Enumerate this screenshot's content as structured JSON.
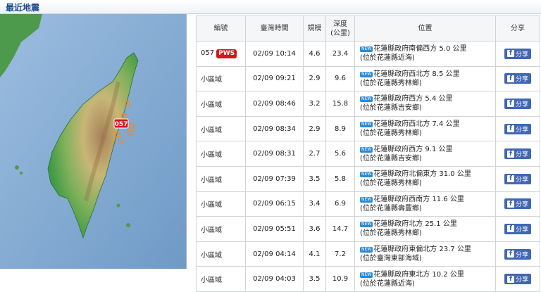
{
  "section_title": "最近地震",
  "table": {
    "headers": {
      "no": "編號",
      "time": "臺灣時間",
      "mag": "規模",
      "depth_line1": "深度",
      "depth_line2": "(公里)",
      "loc": "位置",
      "share": "分享"
    },
    "badge_new": "NEW",
    "share_label": "分享",
    "rows": [
      {
        "no": "057",
        "pws": "PWS",
        "time": "02/09 10:14",
        "mag": "4.6",
        "depth": "23.4",
        "loc1": "花蓮縣政府南偏西方 5.0 公里",
        "loc2": "(位於花蓮縣近海)"
      },
      {
        "no": "小區域",
        "time": "02/09 09:21",
        "mag": "2.9",
        "depth": "9.6",
        "loc1": "花蓮縣政府西北方 8.5 公里",
        "loc2": "(位於花蓮縣秀林鄉)"
      },
      {
        "no": "小區域",
        "time": "02/09 08:46",
        "mag": "3.2",
        "depth": "15.8",
        "loc1": "花蓮縣政府西方 5.4 公里",
        "loc2": "(位於花蓮縣吉安鄉)"
      },
      {
        "no": "小區域",
        "time": "02/09 08:34",
        "mag": "2.9",
        "depth": "8.9",
        "loc1": "花蓮縣政府西北方 7.4 公里",
        "loc2": "(位於花蓮縣秀林鄉)"
      },
      {
        "no": "小區域",
        "time": "02/09 08:31",
        "mag": "2.7",
        "depth": "5.6",
        "loc1": "花蓮縣政府西方 9.1 公里",
        "loc2": "(位於花蓮縣吉安鄉)"
      },
      {
        "no": "小區域",
        "time": "02/09 07:39",
        "mag": "3.5",
        "depth": "5.8",
        "loc1": "花蓮縣政府北偏東方 31.0 公里",
        "loc2": "(位於花蓮縣秀林鄉)"
      },
      {
        "no": "小區域",
        "time": "02/09 06:15",
        "mag": "3.4",
        "depth": "6.9",
        "loc1": "花蓮縣政府西南方 11.6 公里",
        "loc2": "(位於花蓮縣壽豐鄉)"
      },
      {
        "no": "小區域",
        "time": "02/09 05:51",
        "mag": "3.6",
        "depth": "14.7",
        "loc1": "花蓮縣政府北方 25.1 公里",
        "loc2": "(位於花蓮縣秀林鄉)"
      },
      {
        "no": "小區域",
        "time": "02/09 04:14",
        "mag": "4.1",
        "depth": "7.2",
        "loc1": "花蓮縣政府東偏北方 23.7 公里",
        "loc2": "(位於臺灣東部海域)"
      },
      {
        "no": "小區域",
        "time": "02/09 04:03",
        "mag": "3.5",
        "depth": "10.9",
        "loc1": "花蓮縣政府東北方 10.2 公里",
        "loc2": "(位於花蓮縣近海)"
      }
    ]
  },
  "map": {
    "marker_label": "057",
    "colors": {
      "sea": "#7ea6cf",
      "land_low": "#3f9a46",
      "land_mid": "#c8b677",
      "land_high": "#a8825a",
      "marker": "#d9141b",
      "small_marker": "#ee8a22"
    }
  }
}
